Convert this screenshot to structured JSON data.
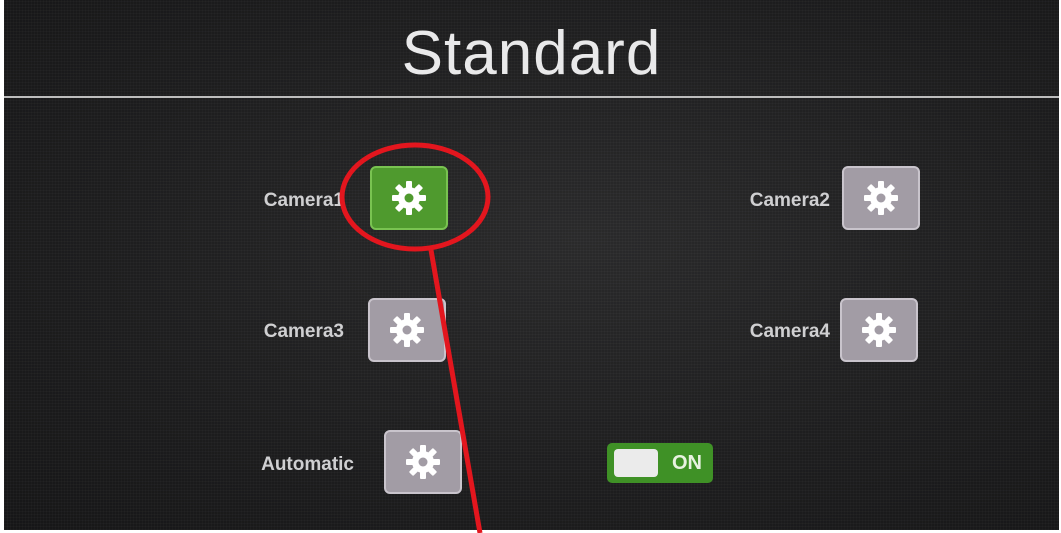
{
  "title": "Standard",
  "cameras": [
    {
      "label": "Camera1",
      "icon": "gear-icon",
      "active": true
    },
    {
      "label": "Camera2",
      "icon": "gear-icon",
      "active": false
    },
    {
      "label": "Camera3",
      "icon": "gear-icon",
      "active": false
    },
    {
      "label": "Camera4",
      "icon": "gear-icon",
      "active": false
    }
  ],
  "automatic": {
    "label": "Automatic",
    "icon": "gear-icon"
  },
  "toggle": {
    "state_label": "ON",
    "on": true
  },
  "annotation": {
    "type": "red-circle-with-arrow",
    "color": "#e3161e",
    "target": "Camera1 settings button"
  },
  "colors": {
    "background": "#1d1d1e",
    "active_button": "#4f9a2e",
    "inactive_button": "#a29ca5",
    "toggle_on": "#3f9126",
    "annotation": "#e3161e"
  }
}
